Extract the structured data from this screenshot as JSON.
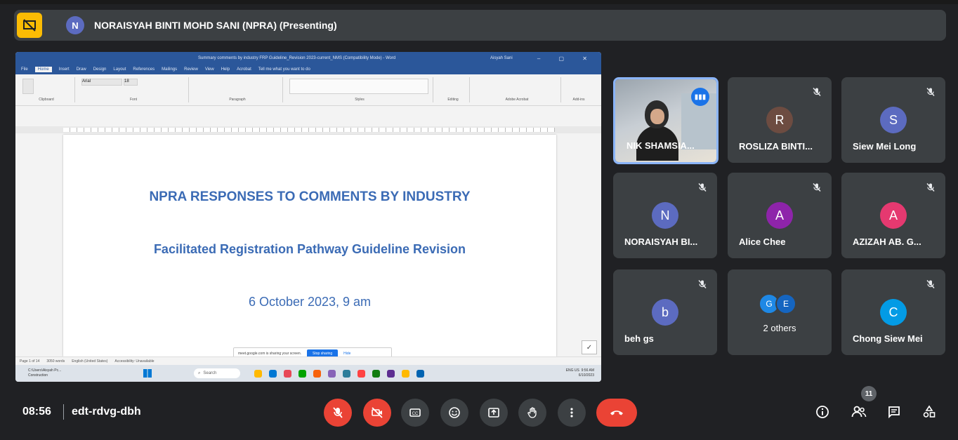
{
  "presenter_bar": {
    "avatar_letter": "N",
    "title": "NORAISYAH BINTI MOHD SANI (NPRA) (Presenting)",
    "icon": "stop-presenting-icon"
  },
  "shared_screen": {
    "window_title": "Summary comments by industry FRP Guideline_Revision 2023-current_NMS (Compatibility Mode) - Word",
    "user_label": "Aisyah Sani",
    "menu_tabs": [
      "File",
      "Home",
      "Insert",
      "Draw",
      "Design",
      "Layout",
      "References",
      "Mailings",
      "Review",
      "View",
      "Help",
      "Acrobat",
      "Tell me what you want to do"
    ],
    "ribbon_groups": [
      "Clipboard",
      "Font",
      "Paragraph",
      "Styles",
      "Editing",
      "Adobe Acrobat",
      "Add-ins"
    ],
    "font_name": "Arial",
    "font_size": "18",
    "doc_heading": "NPRA RESPONSES TO COMMENTS BY INDUSTRY",
    "doc_subheading": "Facilitated Registration Pathway Guideline Revision",
    "doc_date": "6 October 2023, 9 am",
    "share_notice_text": "meet.google.com is sharing your screen.",
    "stop_sharing_label": "Stop sharing",
    "hide_label": "Hide",
    "status_items": [
      "Page 1 of 14",
      "3050 words",
      "English (United States)",
      "Accessibility: Unavailable"
    ],
    "taskbar_weather": "C:\\Users\\Aisyah Pc...",
    "taskbar_weather2": "Construction",
    "taskbar_search": "Search",
    "taskbar_lang": "ENG US",
    "taskbar_time": "9:56 AM",
    "taskbar_date": "6/10/2023",
    "taskbar_app_colors": [
      "#ffb900",
      "#0078d4",
      "#e74856",
      "#00a300",
      "#f7630c",
      "#8764b8",
      "#2d7d9a",
      "#ff4343",
      "#107c10",
      "#5c2d91",
      "#ffb900",
      "#0063b1"
    ]
  },
  "participants": [
    {
      "name": "NIK SHAMSIA...",
      "type": "video",
      "speaking": true
    },
    {
      "name": "ROSLIZA BINTI...",
      "letter": "R",
      "color": "#6d4c41",
      "muted": true
    },
    {
      "name": "Siew Mei Long",
      "letter": "S",
      "color": "#5c6bc0",
      "muted": true
    },
    {
      "name": "NORAISYAH BI...",
      "letter": "N",
      "color": "#5c6bc0",
      "muted": true
    },
    {
      "name": "Alice Chee",
      "letter": "A",
      "color": "#8e24aa",
      "muted": true
    },
    {
      "name": "AZIZAH AB. G...",
      "letter": "A",
      "color": "#e53970",
      "muted": true
    },
    {
      "name": "beh gs",
      "letter": "b",
      "color": "#5c6bc0",
      "muted": true
    },
    {
      "name": "2 others",
      "type": "others",
      "letters": [
        "G",
        "E"
      ],
      "colors": [
        "#1e88e5",
        "#1565c0"
      ]
    },
    {
      "name": "Chong Siew Mei",
      "letter": "C",
      "color": "#039be5",
      "muted": true
    }
  ],
  "bottom_bar": {
    "time": "08:56",
    "meeting_code": "edt-rdvg-dbh",
    "people_count": "11",
    "controls": [
      "mic-off",
      "camera-off",
      "captions",
      "emoji",
      "present",
      "raise-hand",
      "more-options",
      "leave-call"
    ],
    "right_controls": [
      "info",
      "people",
      "chat",
      "activities"
    ]
  }
}
